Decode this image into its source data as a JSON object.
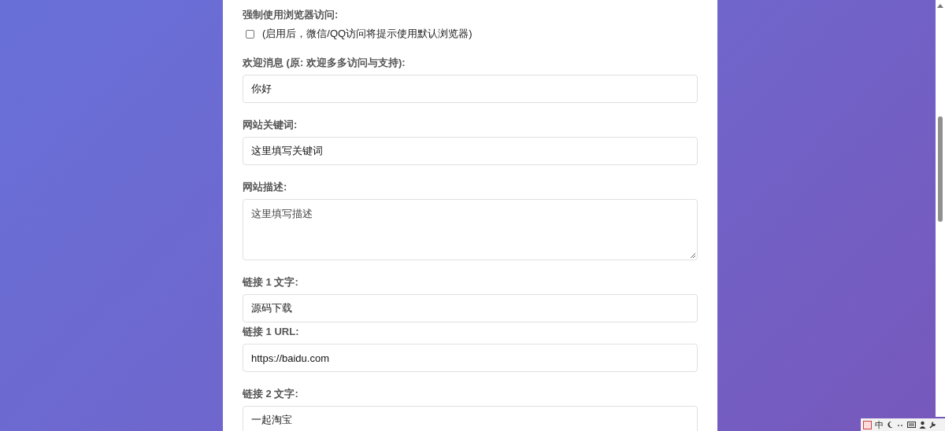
{
  "sections": [
    {
      "fields": [
        {
          "kind": "checkbox",
          "label": "强制使用浏览器访问:",
          "checked": false,
          "hint": "(启用后，微信/QQ访问将提示使用默认浏览器)"
        }
      ]
    },
    {
      "fields": [
        {
          "kind": "input",
          "label": "欢迎消息 (原: 欢迎多多访问与支持):",
          "value": "你好"
        }
      ]
    },
    {
      "fields": [
        {
          "kind": "input",
          "label": "网站关键词:",
          "value": "这里填写关键词"
        }
      ]
    },
    {
      "fields": [
        {
          "kind": "textarea",
          "label": "网站描述:",
          "value": "这里填写描述"
        }
      ]
    },
    {
      "fields": [
        {
          "kind": "input",
          "label": "链接 1 文字:",
          "value": "源码下载"
        },
        {
          "kind": "input",
          "label": "链接 1 URL:",
          "value": "https://baidu.com"
        }
      ]
    },
    {
      "fields": [
        {
          "kind": "input",
          "label": "链接 2 文字:",
          "value": "一起淘宝"
        }
      ]
    }
  ],
  "ime_bar": {
    "mode": "中"
  }
}
